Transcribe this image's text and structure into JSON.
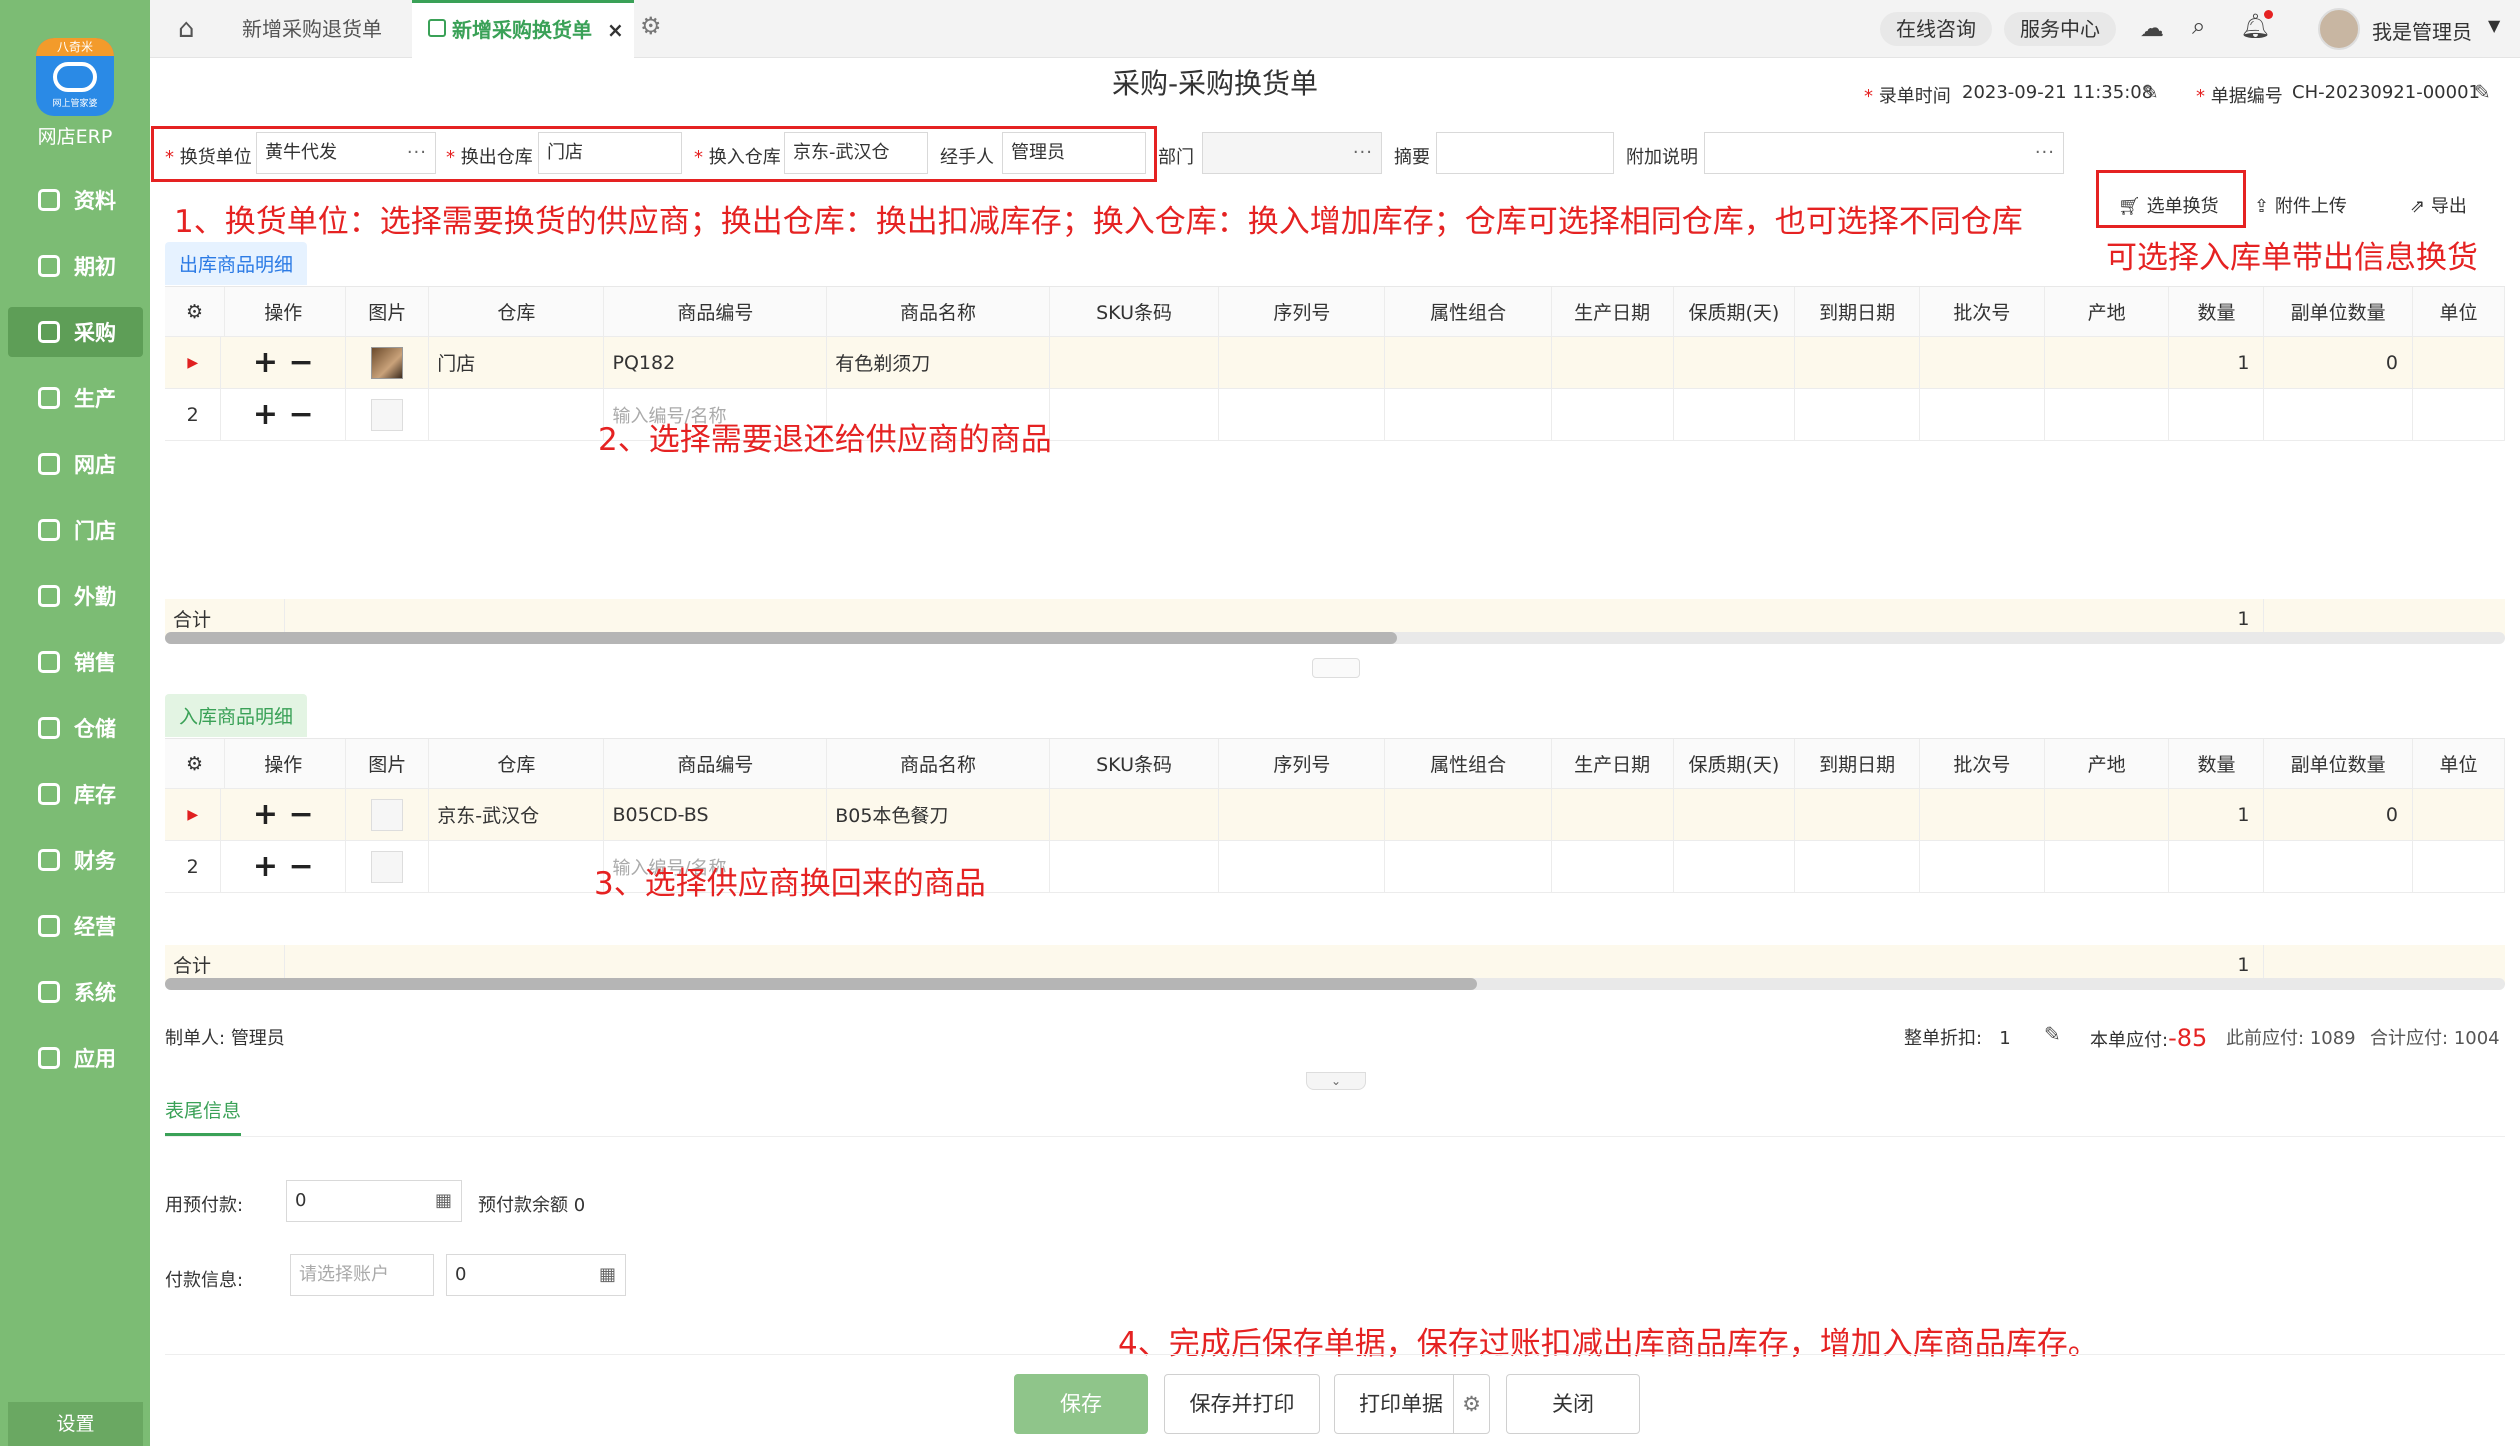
{
  "app": {
    "name": "网店ERP",
    "logo_top": "八奇米",
    "logo_sub": "网上管家婆"
  },
  "sidebar": {
    "items": [
      {
        "label": "资料"
      },
      {
        "label": "期初"
      },
      {
        "label": "采购"
      },
      {
        "label": "生产"
      },
      {
        "label": "网店"
      },
      {
        "label": "门店"
      },
      {
        "label": "外勤"
      },
      {
        "label": "销售"
      },
      {
        "label": "仓储"
      },
      {
        "label": "库存"
      },
      {
        "label": "财务"
      },
      {
        "label": "经营"
      },
      {
        "label": "系统"
      },
      {
        "label": "应用"
      }
    ],
    "active": "采购",
    "settings": "设置"
  },
  "tabs": [
    {
      "label": "新增采购退货单"
    },
    {
      "label": "新增采购换货单"
    }
  ],
  "topbar": {
    "consult": "在线咨询",
    "service": "服务中心",
    "user": "我是管理员"
  },
  "header": {
    "title": "采购-采购换货单",
    "entry_time_label": "录单时间",
    "entry_time": "2023-09-21 11:35:08",
    "doc_no_label": "单据编号",
    "doc_no": "CH-20230921-00001"
  },
  "form": {
    "unit_label": "换货单位",
    "unit": "黄牛代发",
    "out_wh_label": "换出仓库",
    "out_wh": "门店",
    "in_wh_label": "换入仓库",
    "in_wh": "京东-武汉仓",
    "handler_label": "经手人",
    "handler": "管理员",
    "dept_label": "部门",
    "dept": "",
    "summary_label": "摘要",
    "summary": "",
    "note_label": "附加说明",
    "note": ""
  },
  "actions": {
    "select_exchange": "选单换货",
    "attach": "附件上传",
    "export": "导出"
  },
  "annotations": {
    "a1": "1、换货单位：选择需要换货的供应商；换出仓库：换出扣减库存；换入仓库：换入增加库存；仓库可选择相同仓库，也可选择不同仓库",
    "a_right": "可选择入库单带出信息换货",
    "a2": "2、选择需要退还给供应商的商品",
    "a3": "3、选择供应商换回来的商品",
    "a4": "4、完成后保存单据，保存过账扣减出库商品库存，增加入库商品库存。"
  },
  "columns": [
    "操作",
    "图片",
    "仓库",
    "商品编号",
    "商品名称",
    "SKU条码",
    "序列号",
    "属性组合",
    "生产日期",
    "保质期(天)",
    "到期日期",
    "批次号",
    "产地",
    "数量",
    "副单位数量",
    "单位"
  ],
  "out_section": {
    "title": "出库商品明细",
    "rows": [
      {
        "no": "",
        "warehouse": "门店",
        "code": "PQ182",
        "name": "有色剃须刀",
        "qty": "1",
        "sub_qty": "0"
      },
      {
        "no": "2",
        "warehouse": "",
        "code": "",
        "name": "",
        "qty": "",
        "sub_qty": ""
      }
    ],
    "placeholder": "输入编号/名称",
    "total_label": "合计",
    "total_qty": "1"
  },
  "in_section": {
    "title": "入库商品明细",
    "rows": [
      {
        "no": "",
        "warehouse": "京东-武汉仓",
        "code": "B05CD-BS",
        "name": "B05本色餐刀",
        "qty": "1",
        "sub_qty": "0"
      },
      {
        "no": "2",
        "warehouse": "",
        "code": "",
        "name": "",
        "qty": "",
        "sub_qty": ""
      }
    ],
    "placeholder": "输入编号/名称",
    "total_label": "合计",
    "total_qty": "1"
  },
  "footer_info": {
    "maker_label": "制单人:",
    "maker": "管理员",
    "discount_label": "整单折扣:",
    "discount": "1",
    "payable_label": "本单应付:",
    "payable": "-85",
    "prev_payable_label": "此前应付:",
    "prev_payable": "1089",
    "total_payable_label": "合计应付:",
    "total_payable": "1004"
  },
  "tail": {
    "tab": "表尾信息",
    "prepay_label": "用预付款:",
    "prepay": "0",
    "prepay_balance_label": "预付款余额",
    "prepay_balance": "0",
    "pay_label": "付款信息:",
    "account_placeholder": "请选择账户",
    "pay_amount": "0"
  },
  "buttons": {
    "save": "保存",
    "save_print": "保存并打印",
    "print": "打印单据",
    "close": "关闭"
  }
}
